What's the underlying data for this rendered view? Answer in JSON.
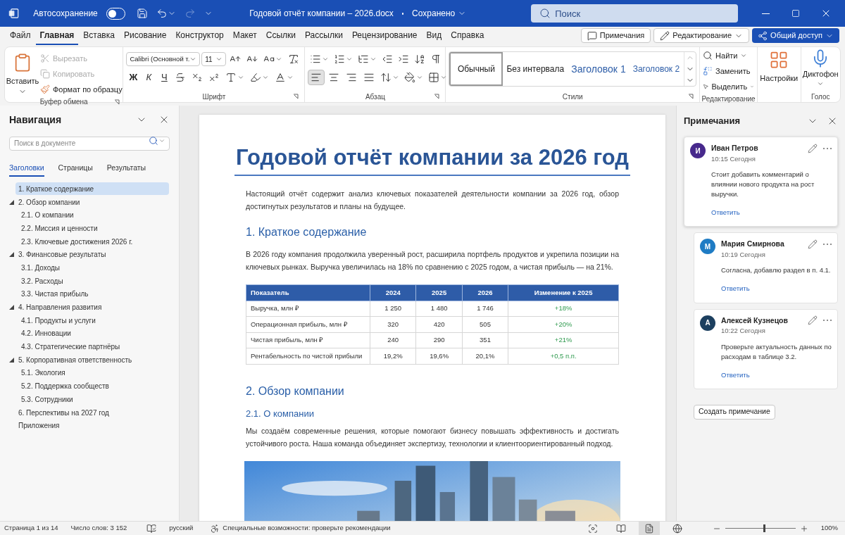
{
  "title_bar": {
    "autosave_label": "Автосохранение",
    "autosave_on": false,
    "redo_disabled": true,
    "document_title": "Годовой отчёт компании – 2026.docx",
    "save_state": "Сохранено",
    "search_placeholder": "Поиск"
  },
  "ribbon_tabs": [
    {
      "label": "Файл",
      "selected": false
    },
    {
      "label": "Главная",
      "selected": true
    },
    {
      "label": "Вставка",
      "selected": false
    },
    {
      "label": "Рисование",
      "selected": false
    },
    {
      "label": "Конструктор",
      "selected": false
    },
    {
      "label": "Макет",
      "selected": false
    },
    {
      "label": "Ссылки",
      "selected": false
    },
    {
      "label": "Рассылки",
      "selected": false
    },
    {
      "label": "Рецензирование",
      "selected": false
    },
    {
      "label": "Вид",
      "selected": false
    },
    {
      "label": "Справка",
      "selected": false
    }
  ],
  "header_buttons": {
    "comments": "Примечания",
    "editing": "Редактирование",
    "share": "Общий доступ"
  },
  "ribbon": {
    "clipboard": {
      "paste": "Вставить",
      "cut": "Вырезать",
      "cut_disabled": true,
      "copy": "Копировать",
      "copy_disabled": true,
      "format_painter": "Формат по образцу",
      "group": "Буфер обмена"
    },
    "font": {
      "font_name": "Calibri (Основной т.",
      "font_size": "11",
      "bold": "Ж",
      "italic": "К",
      "underline": "Ч",
      "group": "Шрифт"
    },
    "paragraph": {
      "group": "Абзац",
      "alignments": [
        {
          "kind": "left",
          "selected": true
        },
        {
          "kind": "center",
          "selected": false
        },
        {
          "kind": "right",
          "selected": false
        },
        {
          "kind": "justify",
          "selected": false
        }
      ]
    },
    "styles": {
      "group": "Стили",
      "items": [
        {
          "label": "Обычный",
          "kind": "normal",
          "selected": true
        },
        {
          "label": "Без интервала",
          "kind": "plain",
          "selected": false
        },
        {
          "label": "Заголовок 1",
          "kind": "heading1",
          "selected": false
        },
        {
          "label": "Заголовок 2",
          "kind": "heading2",
          "selected": false
        }
      ]
    },
    "editing": {
      "group": "Редактирование",
      "find": "Найти",
      "replace": "Заменить",
      "select": "Выделить"
    },
    "addins": {
      "label": "Настройки"
    },
    "voice": {
      "label": "Диктофон",
      "group": "Голос"
    }
  },
  "navigation": {
    "title": "Навигация",
    "search_placeholder": "Поиск в документе",
    "tabs": [
      {
        "label": "Заголовки",
        "selected": true
      },
      {
        "label": "Страницы",
        "selected": false
      },
      {
        "label": "Результаты",
        "selected": false
      }
    ],
    "headings": [
      {
        "label": "1. Краткое содержание",
        "selected": true
      },
      {
        "label": "2. Обзор компании",
        "selected": false,
        "expanded": true,
        "children": [
          {
            "label": "2.1. О компании",
            "selected": false
          },
          {
            "label": "2.2. Миссия и ценности",
            "selected": false
          },
          {
            "label": "2.3. Ключевые достижения 2026 г.",
            "selected": false
          }
        ]
      },
      {
        "label": "3. Финансовые результаты",
        "selected": false,
        "expanded": true,
        "children": [
          {
            "label": "3.1. Доходы",
            "selected": false
          },
          {
            "label": "3.2. Расходы",
            "selected": false
          },
          {
            "label": "3.3. Чистая прибыль",
            "selected": false
          }
        ]
      },
      {
        "label": "4. Направления развития",
        "selected": false,
        "expanded": true,
        "children": [
          {
            "label": "4.1. Продукты и услуги",
            "selected": false
          },
          {
            "label": "4.2. Инновации",
            "selected": false
          },
          {
            "label": "4.3. Стратегические партнёры",
            "selected": false
          }
        ]
      },
      {
        "label": "5. Корпоративная ответственность",
        "selected": false,
        "expanded": true,
        "children": [
          {
            "label": "5.1. Экология",
            "selected": false
          },
          {
            "label": "5.2. Поддержка сообществ",
            "selected": false
          },
          {
            "label": "5.3. Сотрудники",
            "selected": false
          }
        ]
      },
      {
        "label": "6. Перспективы на 2027 год",
        "selected": false
      },
      {
        "label": "Приложения",
        "selected": false
      }
    ]
  },
  "document": {
    "blocks": [
      {
        "kind": "title",
        "text": "Годовой отчёт компании за 2026 год"
      },
      {
        "kind": "paragraph",
        "text": "Настоящий отчёт содержит анализ ключевых показателей деятельности компании за 2026 год, обзор достигнутых результатов и планы на будущее."
      },
      {
        "kind": "heading1",
        "text": "1. Краткое содержание"
      },
      {
        "kind": "paragraph",
        "text": "В 2026 году компания продолжила уверенный рост, расширила портфель продуктов и укрепила позиции на ключевых рынках. Выручка увеличилась на 18% по сравнению с 2025 годом, а чистая прибыль — на 21%."
      },
      {
        "kind": "table",
        "columns": [
          "Показатель",
          "2024",
          "2025",
          "2026",
          "Изменение к 2025"
        ],
        "rows": [
          [
            "Выручка, млн ₽",
            "1 250",
            "1 480",
            "1 746",
            "+18%"
          ],
          [
            "Операционная прибыль, млн ₽",
            "320",
            "420",
            "505",
            "+20%"
          ],
          [
            "Чистая прибыль, млн ₽",
            "240",
            "290",
            "351",
            "+21%"
          ],
          [
            "Рентабельность по чистой прибыли",
            "19,2%",
            "19,6%",
            "20,1%",
            "+0,5 п.п."
          ]
        ]
      },
      {
        "kind": "heading1",
        "text": "2. Обзор компании"
      },
      {
        "kind": "heading2",
        "text": "2.1. О компании"
      },
      {
        "kind": "paragraph",
        "text": "Мы создаём современные решения, которые помогают бизнесу повышать эффективность и достигать устойчивого роста. Наша команда объединяет экспертизу, технологии  и клиентоориентированный подход."
      },
      {
        "kind": "picture"
      }
    ]
  },
  "comments": {
    "title": "Примечания",
    "items": [
      {
        "author": "Иван Петров",
        "initial": "И",
        "color": "#47298c",
        "time": "10:15 Сегодня",
        "text": "Стоит добавить комментарий о влиянии нового продукта на рост выручки.",
        "reply": "Ответить",
        "selected": true
      },
      {
        "author": "Мария Смирнова",
        "initial": "М",
        "color": "#1f7cc4",
        "time": "10:19 Сегодня",
        "text": "Согласна, добавлю раздел в п. 4.1.",
        "reply": "Ответить",
        "selected": false
      },
      {
        "author": "Алексей Кузнецов",
        "initial": "А",
        "color": "#1c3f5f",
        "time": "10:22 Сегодня",
        "text": "Проверьте актуальность данных по расходам в таблице 3.2.",
        "reply": "Ответить",
        "selected": false
      }
    ],
    "new_comment": "Создать примечание"
  },
  "status_bar": {
    "page": "Страница 1 из 14",
    "words": "Число слов: 3 152",
    "language": "русский",
    "accessibility": "Специальные возможности: проверьте рекомендации",
    "views": [
      {
        "kind": "focus",
        "selected": false
      },
      {
        "kind": "read",
        "selected": false
      },
      {
        "kind": "print",
        "selected": true
      },
      {
        "kind": "web",
        "selected": false
      }
    ],
    "zoom": {
      "level": 0.55,
      "label": "100%"
    }
  }
}
